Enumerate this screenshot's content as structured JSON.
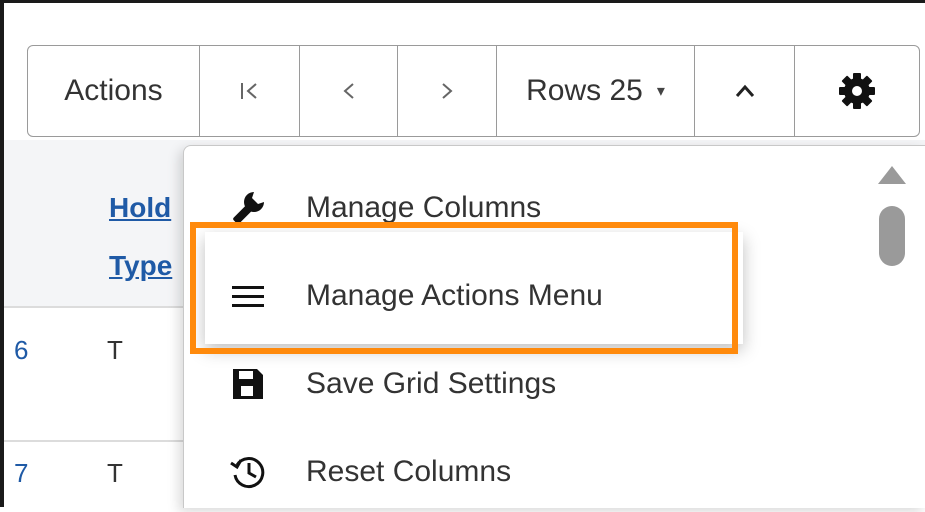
{
  "toolbar": {
    "actions_label": "Actions",
    "first_icon": "|<",
    "prev_icon": "<",
    "next_icon": ">",
    "rows_label": "Rows 25",
    "rows_caret": "▾",
    "collapse_icon": "^",
    "settings_icon": "gear-icon"
  },
  "grid": {
    "column_header_line1": "Hold",
    "column_header_line2": "Type",
    "rows": [
      {
        "num": "6",
        "value": "T"
      },
      {
        "num": "7",
        "value": "T"
      }
    ]
  },
  "menu": {
    "items": [
      {
        "label": "Manage Columns",
        "icon": "wrench-icon"
      },
      {
        "label": "Manage Actions Menu",
        "icon": "hamburger-icon"
      },
      {
        "label": "Save Grid Settings",
        "icon": "save-icon"
      },
      {
        "label": "Reset Columns",
        "icon": "history-icon"
      }
    ],
    "highlighted_item": "Manage Actions Menu"
  },
  "colors": {
    "highlight": "#ff8a0c",
    "link": "#1f5aa6"
  }
}
